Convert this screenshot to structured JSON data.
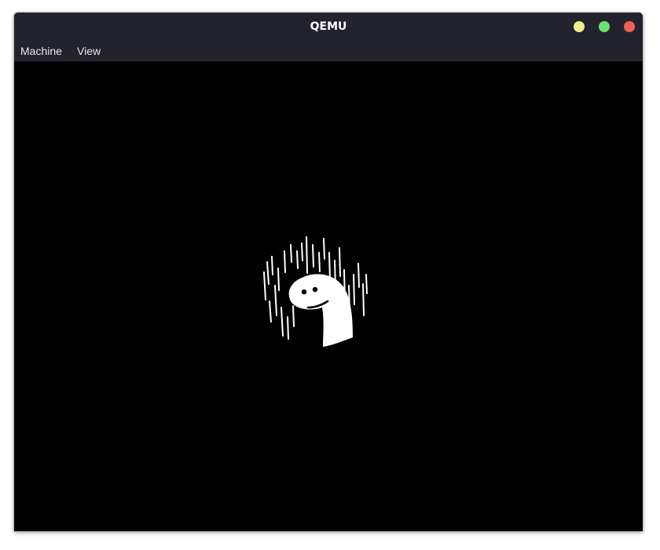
{
  "window": {
    "title": "QEMU"
  },
  "window_controls": {
    "minimize_color": "#f0ef8c",
    "maximize_color": "#6be36f",
    "close_color": "#f25f5a"
  },
  "menubar": {
    "items": [
      {
        "label": "Machine"
      },
      {
        "label": "View"
      }
    ]
  },
  "guest_display": {
    "background_color": "#000000",
    "content_icon": "dino-in-rain-icon"
  }
}
